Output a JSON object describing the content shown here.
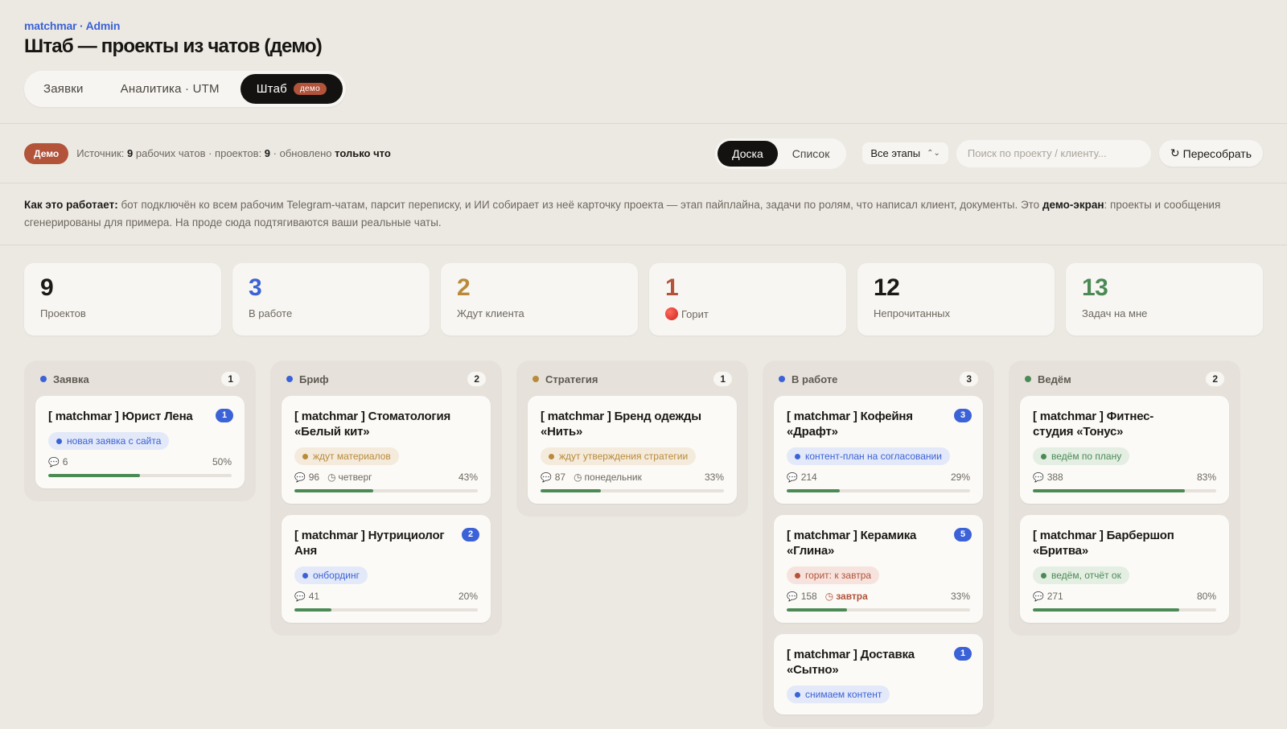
{
  "header": {
    "brand": "matchmar · Admin",
    "title": "Штаб — проекты из чатов (демо)",
    "tabs": [
      {
        "label": "Заявки"
      },
      {
        "label": "Аналитика · UTM"
      },
      {
        "label": "Штаб",
        "badge": "демо"
      }
    ]
  },
  "toolbar": {
    "demo_label": "Демо",
    "source_prefix": "Источник: ",
    "chats_count": "9",
    "chats_text": " рабочих чатов · проектов: ",
    "projects_count": "9",
    "updated_text": " · обновлено ",
    "updated_value": "только что",
    "view_board": "Доска",
    "view_list": "Список",
    "stage_filter": "Все этапы",
    "search_placeholder": "Поиск по проекту / клиенту...",
    "rebuild_label": "Пересобрать"
  },
  "info": {
    "lead": "Как это работает:",
    "text1": " бот подключён ко всем рабочим Telegram-чатам, парсит переписку, и ИИ собирает из неё карточку проекта — этап пайплайна, задачи по ролям, что написал клиент, документы. Это ",
    "bold2": "демо-экран",
    "text2": ": проекты и сообщения сгенерированы для примера. На проде сюда подтягиваются ваши реальные чаты."
  },
  "stats": [
    {
      "value": "9",
      "label": "Проектов",
      "color": "#1c1a17"
    },
    {
      "value": "3",
      "label": "В работе",
      "color": "#3b62d6"
    },
    {
      "value": "2",
      "label": "Ждут клиента",
      "color": "#b98a3a"
    },
    {
      "value": "1",
      "label": "Горит",
      "color": "#b2533a"
    },
    {
      "value": "12",
      "label": "Непрочитанных",
      "color": "#1c1a17"
    },
    {
      "value": "13",
      "label": "Задач на мне",
      "color": "#4b8a55"
    }
  ],
  "colors": {
    "blue": "#3b62d6",
    "amber": "#b98a3a",
    "red": "#b2533a",
    "green": "#4b8a55"
  },
  "columns": [
    {
      "title": "Заявка",
      "count": "1",
      "dot": "#3b62d6",
      "cards": [
        {
          "title": "[ matchmar ] Юрист Лена",
          "unread": "1",
          "tag": "новая заявка с сайта",
          "tag_tone": "blue",
          "messages": "6",
          "due": "",
          "progress_label": "50%",
          "progress": 0.5
        }
      ]
    },
    {
      "title": "Бриф",
      "count": "2",
      "dot": "#3b62d6",
      "cards": [
        {
          "title": "[ matchmar ] Стоматология «Белый кит»",
          "unread": "",
          "tag": "ждут материалов",
          "tag_tone": "amber",
          "messages": "96",
          "due": "четверг",
          "progress_label": "43%",
          "progress": 0.43
        },
        {
          "title": "[ matchmar ] Нутрициолог Аня",
          "unread": "2",
          "tag": "онбординг",
          "tag_tone": "blue",
          "messages": "41",
          "due": "",
          "progress_label": "20%",
          "progress": 0.2
        }
      ]
    },
    {
      "title": "Стратегия",
      "count": "1",
      "dot": "#b98a3a",
      "cards": [
        {
          "title": "[ matchmar ] Бренд одежды «Нить»",
          "unread": "",
          "tag": "ждут утверждения стратегии",
          "tag_tone": "amber",
          "messages": "87",
          "due": "понедельник",
          "progress_label": "33%",
          "progress": 0.33
        }
      ]
    },
    {
      "title": "В работе",
      "count": "3",
      "dot": "#3b62d6",
      "cards": [
        {
          "title": "[ matchmar ] Кофейня «Драфт»",
          "unread": "3",
          "tag": "контент-план на согласовании",
          "tag_tone": "blue",
          "messages": "214",
          "due": "",
          "progress_label": "29%",
          "progress": 0.29
        },
        {
          "title": "[ matchmar ] Керамика «Глина»",
          "unread": "5",
          "tag": "горит: к завтра",
          "tag_tone": "red",
          "messages": "158",
          "due": "завтра",
          "due_hot": true,
          "progress_label": "33%",
          "progress": 0.33
        },
        {
          "title": "[ matchmar ] Доставка «Сытно»",
          "unread": "1",
          "tag": "снимаем контент",
          "tag_tone": "blue",
          "messages": "",
          "due": "",
          "progress_label": "",
          "progress": 0
        }
      ]
    },
    {
      "title": "Ведём",
      "count": "2",
      "dot": "#4b8a55",
      "cards": [
        {
          "title": "[ matchmar ] Фитнес-студия «Тонус»",
          "unread": "",
          "tag": "ведём по плану",
          "tag_tone": "green",
          "messages": "388",
          "due": "",
          "progress_label": "83%",
          "progress": 0.83
        },
        {
          "title": "[ matchmar ] Барбершоп «Бритва»",
          "unread": "",
          "tag": "ведём, отчёт ок",
          "tag_tone": "green",
          "messages": "271",
          "due": "",
          "progress_label": "80%",
          "progress": 0.8
        }
      ]
    }
  ]
}
